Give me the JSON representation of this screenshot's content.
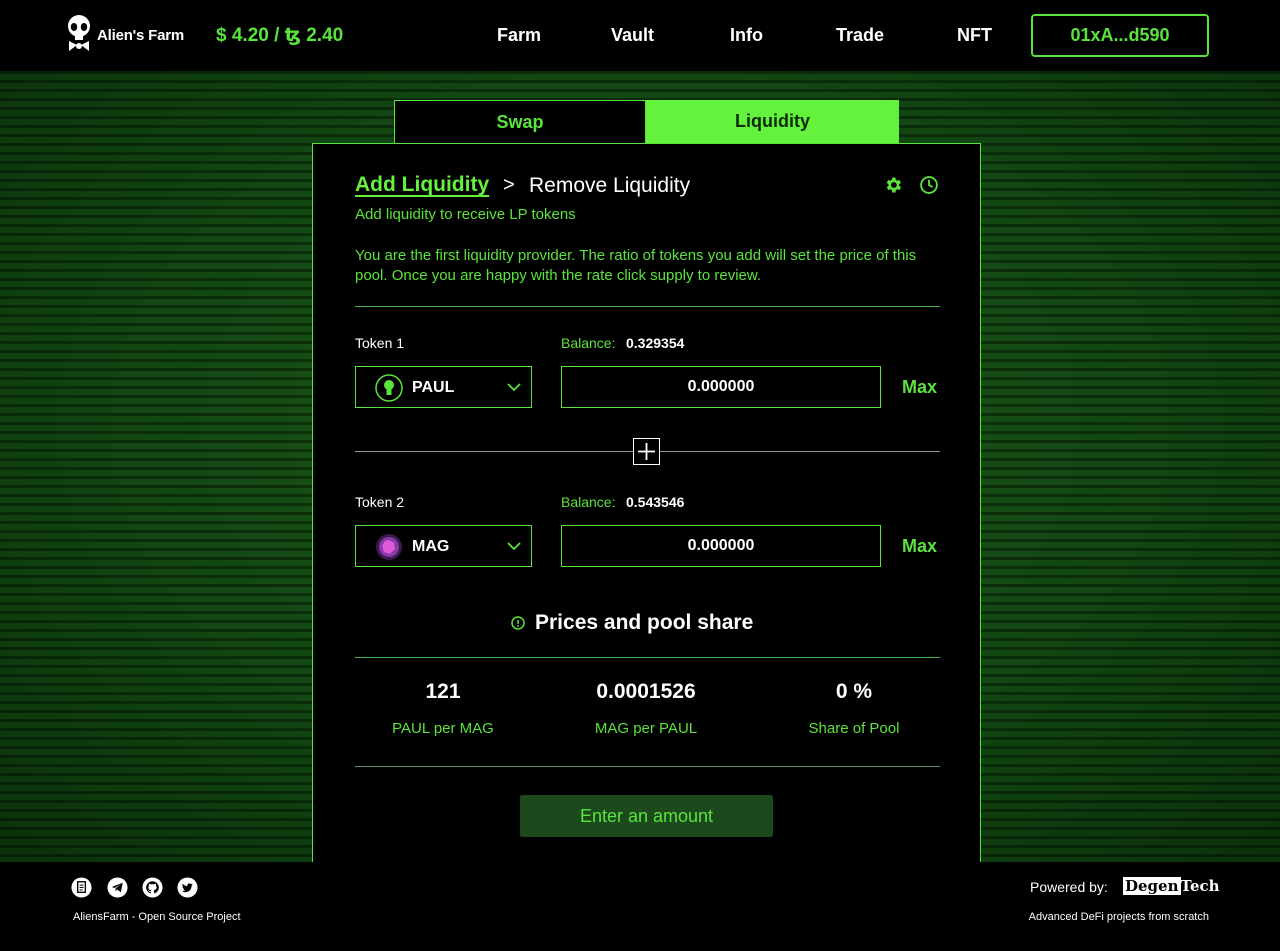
{
  "header": {
    "logo_text": "Alien's Farm",
    "price": "$ 4.20 / ꜩ 2.40",
    "nav": [
      "Farm",
      "Vault",
      "Info",
      "Trade",
      "NFT"
    ],
    "wallet": "01xA...d590"
  },
  "tabs": {
    "swap": "Swap",
    "liquidity": "Liquidity",
    "active": "Liquidity"
  },
  "card": {
    "breadcrumb_add": "Add Liquidity",
    "breadcrumb_sep": ">",
    "breadcrumb_remove": "Remove Liquidity",
    "subtitle": "Add liquidity to receive LP tokens",
    "info": "You are the first liquidity provider. The ratio of tokens you add will set the price of this pool.  Once you are happy with the rate click supply to review.",
    "balance_label": "Balance:",
    "token1": {
      "label": "Token 1",
      "balance": "0.329354",
      "symbol": "PAUL",
      "amount": "0.000000",
      "max": "Max"
    },
    "token2": {
      "label": "Token 2",
      "balance": "0.543546",
      "symbol": "MAG",
      "amount": "0.000000",
      "max": "Max"
    },
    "prices_title": "Prices and pool share",
    "stats": [
      {
        "value": "121",
        "label": "PAUL per MAG"
      },
      {
        "value": "0.0001526",
        "label": "MAG per PAUL"
      },
      {
        "value": "0 %",
        "label": "Share of Pool"
      }
    ],
    "submit": "Enter an amount"
  },
  "footer": {
    "left_text": "AliensFarm - Open Source Project",
    "powered_by": "Powered by:",
    "brand_a": "Degen",
    "brand_b": "Tech",
    "right_text": "Advanced DeFi projects from scratch",
    "icons": [
      "document-icon",
      "telegram-icon",
      "github-icon",
      "twitter-icon"
    ]
  },
  "colors": {
    "accent": "#5be33d",
    "tab_active": "#64f23c",
    "background": "#0d3a0d",
    "button_disabled": "#1c4a1c"
  }
}
